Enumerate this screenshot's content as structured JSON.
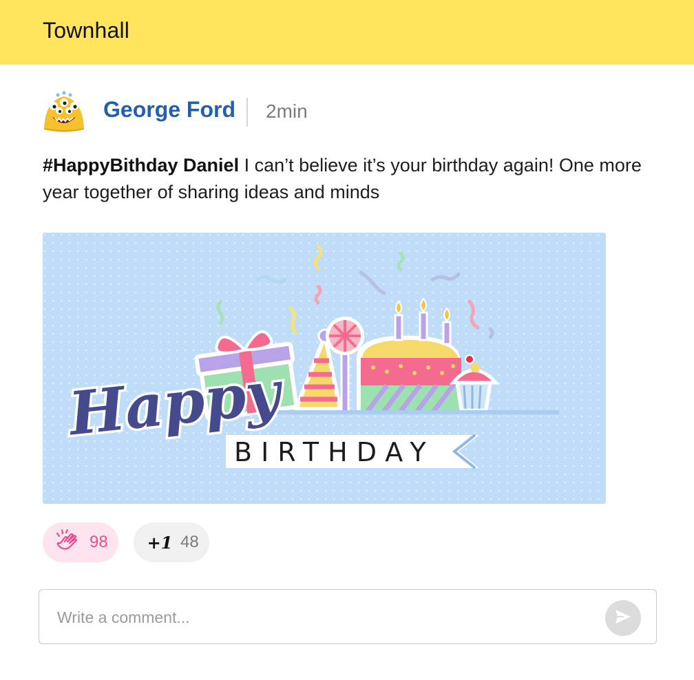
{
  "header": {
    "title": "Townhall"
  },
  "post": {
    "author": "George Ford",
    "time": "2min",
    "hashtag": "#HappyBithday Daniel",
    "body": " I can’t believe it’s your birthday again! One more year together of sharing ideas and minds",
    "image": {
      "script_text": "Happy",
      "banner_text": "BIRTHDAY"
    }
  },
  "reactions": {
    "clap": {
      "icon": "clap-icon",
      "count": "98",
      "color": "#EC4A8E"
    },
    "plus_one": {
      "icon_text": "+1",
      "count": "48"
    }
  },
  "comment": {
    "placeholder": "Write a comment..."
  },
  "colors": {
    "header_bg": "#FFE45C",
    "author": "#2160AE",
    "banner_bg": "#BFDDF8"
  }
}
